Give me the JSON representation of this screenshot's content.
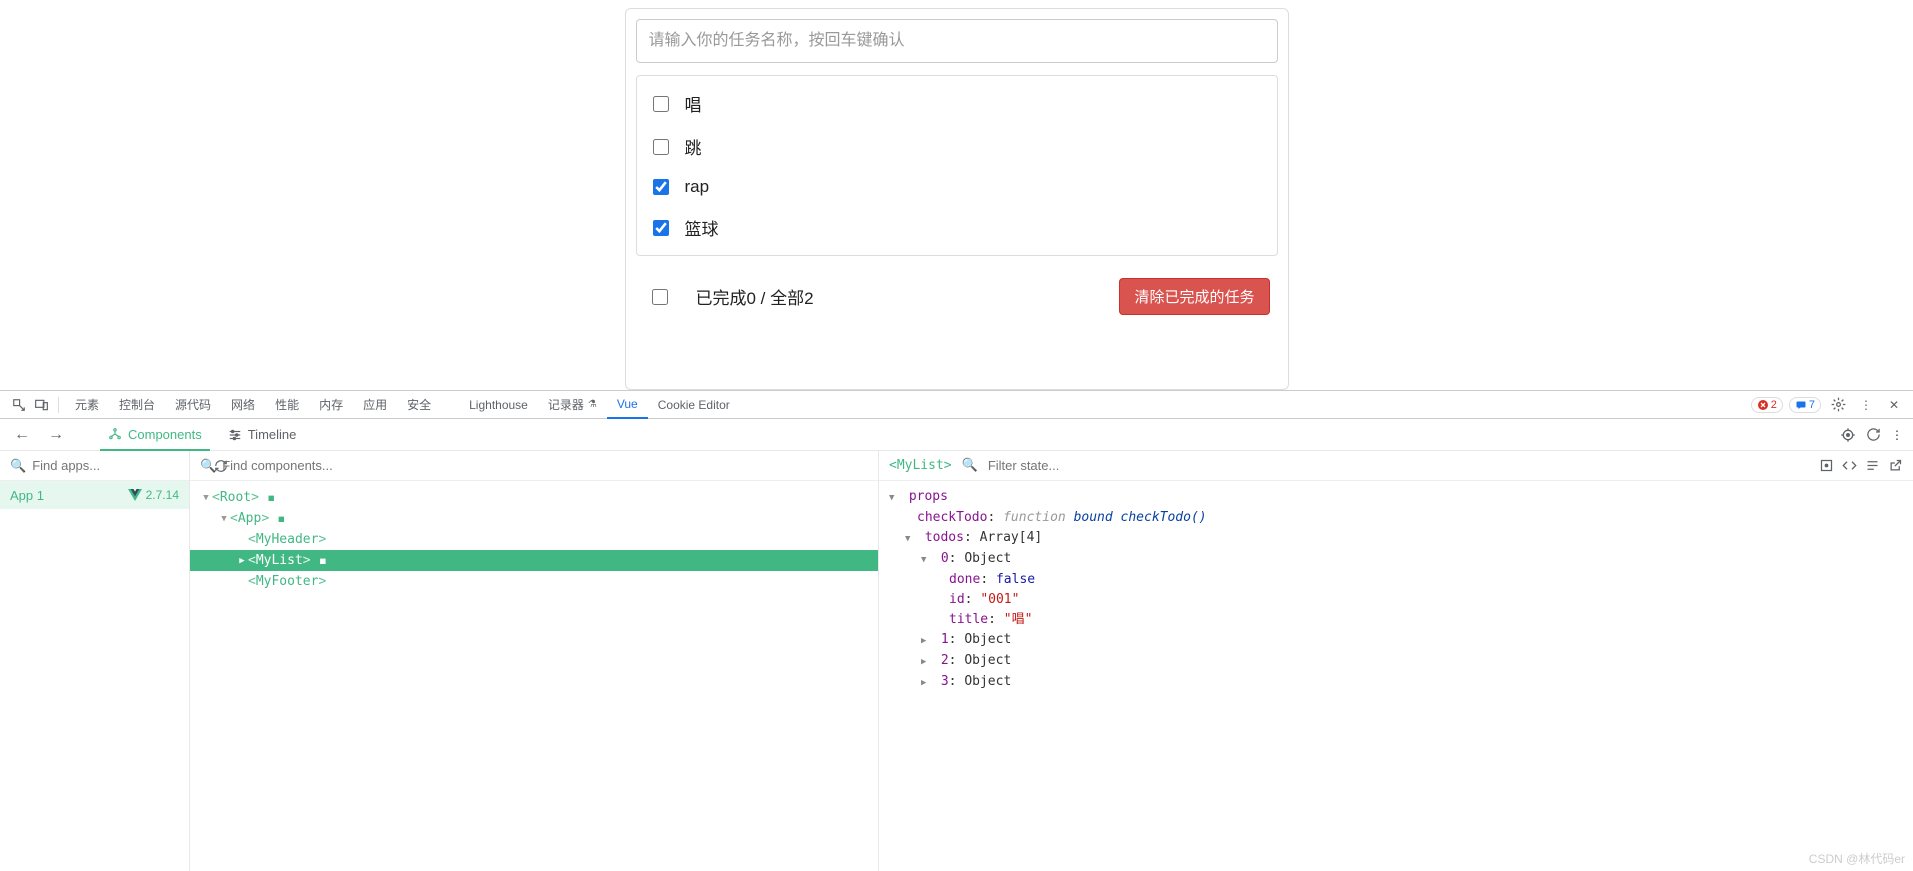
{
  "todo": {
    "input_placeholder": "请输入你的任务名称，按回车键确认",
    "items": [
      {
        "label": "唱",
        "checked": false
      },
      {
        "label": "跳",
        "checked": false
      },
      {
        "label": "rap",
        "checked": true
      },
      {
        "label": "篮球",
        "checked": true
      }
    ],
    "footer_text": "已完成0 / 全部2",
    "clear_btn": "清除已完成的任务"
  },
  "devtools": {
    "tabs": [
      "元素",
      "控制台",
      "源代码",
      "网络",
      "性能",
      "内存",
      "应用",
      "安全",
      "Lighthouse",
      "记录器",
      "Vue",
      "Cookie Editor"
    ],
    "active_tab": "Vue",
    "errors": "2",
    "messages": "7"
  },
  "vue_panel": {
    "tabs": {
      "components": "Components",
      "timeline": "Timeline"
    },
    "apps_placeholder": "Find apps...",
    "tree_placeholder": "Find components...",
    "state_placeholder": "Filter state...",
    "app_name": "App 1",
    "vue_version": "2.7.14",
    "selected_component": "<MyList>",
    "tree": {
      "root": "<Root>",
      "app": "<App>",
      "header": "<MyHeader>",
      "list": "<MyList>",
      "footer": "<MyFooter>"
    },
    "state": {
      "section": "props",
      "checkTodo_key": "checkTodo",
      "checkTodo_type": "function",
      "checkTodo_val": "bound checkTodo()",
      "todos_key": "todos",
      "todos_type": "Array[4]",
      "obj0": {
        "idx": "0",
        "type": "Object",
        "done_k": "done",
        "done_v": "false",
        "id_k": "id",
        "id_v": "\"001\"",
        "title_k": "title",
        "title_v": "\"唱\""
      },
      "obj1": {
        "idx": "1",
        "type": "Object"
      },
      "obj2": {
        "idx": "2",
        "type": "Object"
      },
      "obj3": {
        "idx": "3",
        "type": "Object"
      }
    }
  },
  "watermark": "CSDN @林代码er"
}
